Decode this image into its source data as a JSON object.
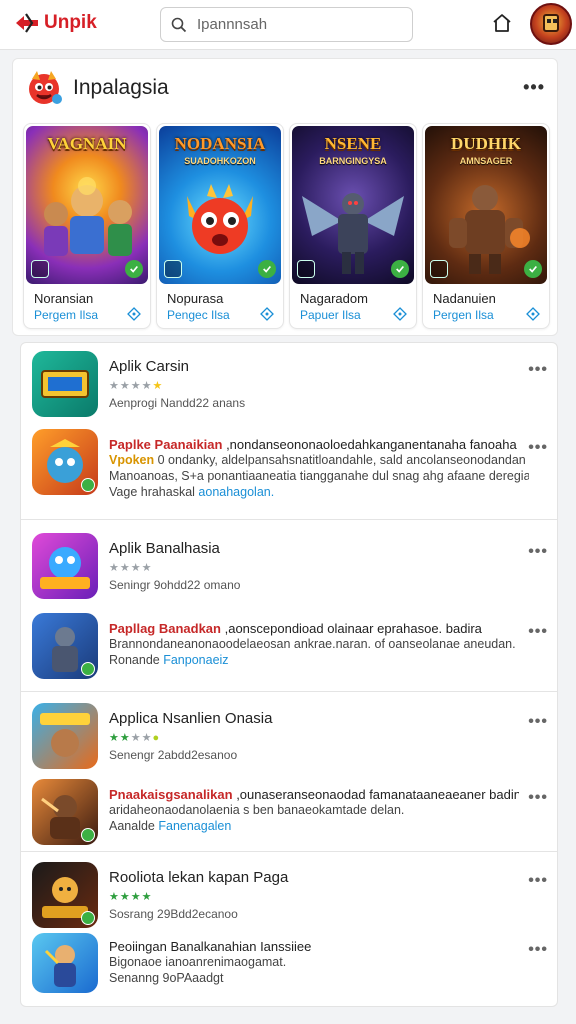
{
  "header": {
    "logo_text": "Unpik",
    "search_placeholder": "Ipannnsah"
  },
  "featured": {
    "title": "Inpalagsia",
    "tiles": [
      {
        "art_title": "VAGNAIN",
        "art_sub": "",
        "name": "Noransian",
        "link": "Pergem Ilsa"
      },
      {
        "art_title": "NODANSIA",
        "art_sub": "SUADOHKOZON",
        "name": "Nopurasa",
        "link": "Pengec Ilsa"
      },
      {
        "art_title": "NSENE",
        "art_sub": "BARNGINGYSA",
        "name": "Nagaradom",
        "link": "Papuer Ilsa"
      },
      {
        "art_title": "DUDHIK",
        "art_sub": "AMNSAGER",
        "name": "Nadanuien",
        "link": "Pergen Ilsa"
      }
    ]
  },
  "list": {
    "apps": [
      {
        "title": "Aplik Carsin",
        "meta": "Aenprogi   Nandd22 anans",
        "stars": 4
      },
      {
        "title": "Aplik Banalhasia",
        "meta": "Seningr   9ohdd22 omano",
        "stars": 4
      },
      {
        "title": "Applica Nsanlien Onasia",
        "meta": "Senengr   2abdd2esanoo",
        "stars": 2
      },
      {
        "title": "Rooliota lekan kapan Paga",
        "meta": "Sosrang   29Bdd2ecanoo",
        "stars": 4
      }
    ],
    "promos": [
      {
        "title_red": "Paplke Paanaikian",
        "title_rest": " ,nondanseononaoloedahkanganentanaha fanoaha",
        "line2_yellow": "Vpoken",
        "line2_rest": " 0 ondanky, aldelpansahsnatitloandahle, sald ancolanseonodandan",
        "line3": "Manoanoas, S+a ponantiaaneatia tiangganahe dul snag ahg afaane deregian.",
        "line4_plain": "Vage hrahaskal ",
        "line4_link": "aonahagolan."
      },
      {
        "title_red": "Papllag Banadkan",
        "title_rest": " ,aonscepondioad olainaar eprahasoe. badira",
        "line2": "Brannondaneanonaoodelaeosan ankrae.naran. of oanseolanae aneudan.",
        "line3_plain": "Ronande ",
        "line3_link": "Fanponaeiz"
      },
      {
        "title_red": "Pnaakaisgsanalikan",
        "title_rest": " ,ounaseranseonaodad famanataaneaeaner badins",
        "line2": "aridaheonaodanolaenia s ben banaeokamtade delan.",
        "line3_plain": "Aanalde ",
        "line3_link": "Fanenagalen"
      },
      {
        "title": "Peoiingan Banalkanahian Ianssiiee",
        "line2": "Bigonaoe ianoanrenimaogamat.",
        "line3": "Senanng 9oPAaadgt"
      }
    ]
  },
  "colors": {
    "accent": "#d61f26",
    "link": "#1a8fd6",
    "star": "#9aa0a6",
    "green": "#3cb043"
  }
}
